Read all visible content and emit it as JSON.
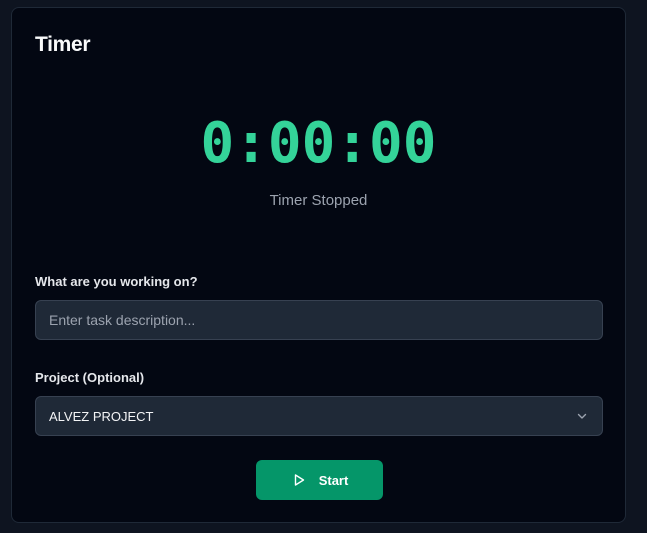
{
  "card": {
    "title": "Timer"
  },
  "timer": {
    "display": "0:00:00",
    "status": "Timer Stopped"
  },
  "task": {
    "label": "What are you working on?",
    "value": "",
    "placeholder": "Enter task description..."
  },
  "project": {
    "label": "Project (Optional)",
    "selected": "ALVEZ PROJECT",
    "icon": "chevron-down-icon"
  },
  "actions": {
    "start_label": "Start",
    "start_icon": "play-icon"
  },
  "colors": {
    "accent": "#34d399",
    "button": "#059669",
    "background": "#030712",
    "field": "#1f2937"
  }
}
